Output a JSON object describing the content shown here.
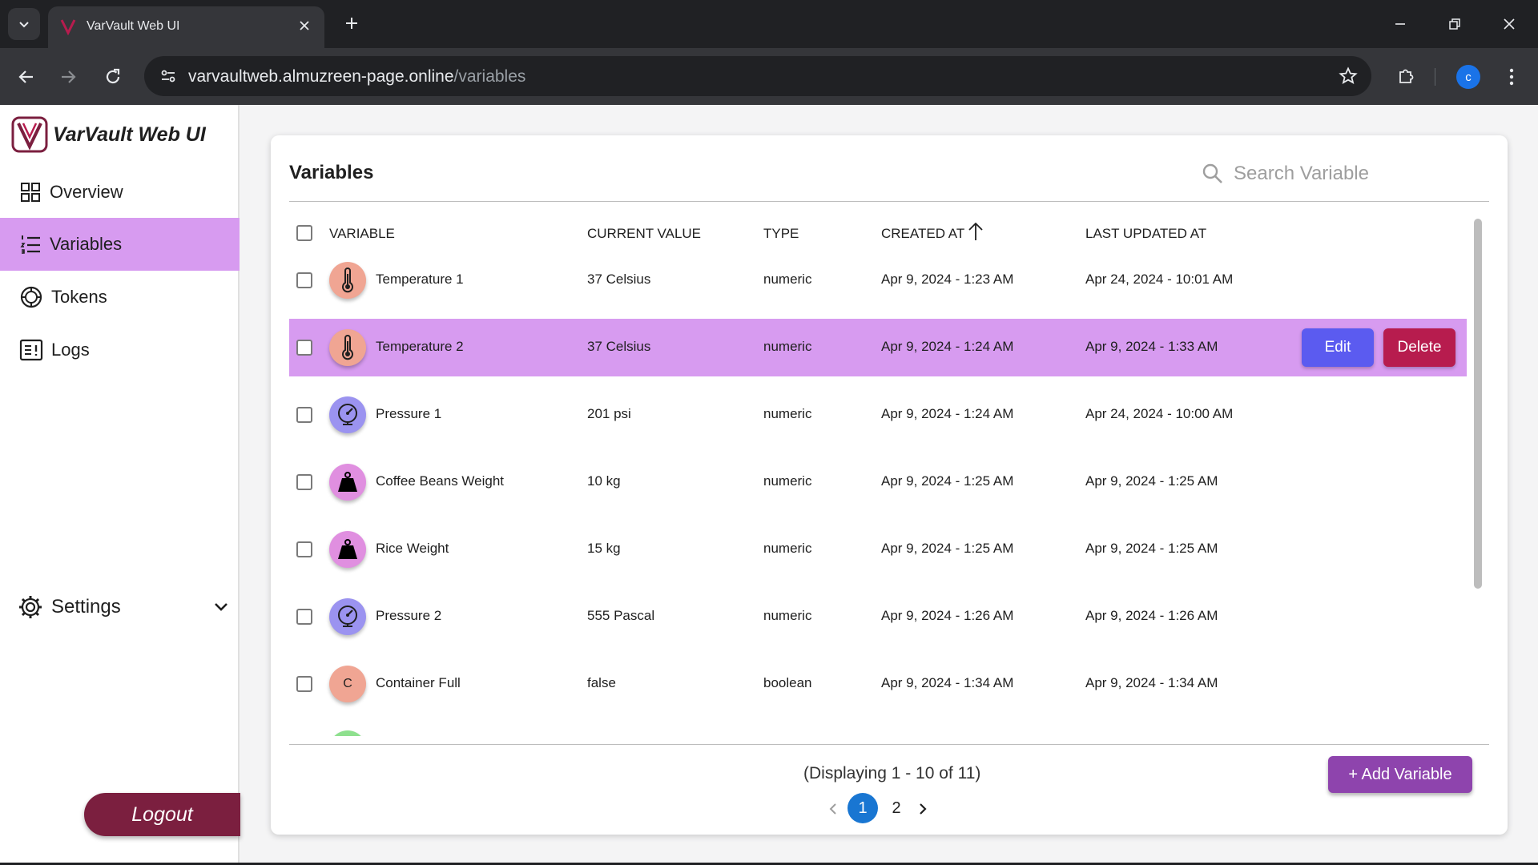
{
  "browser": {
    "tab_title": "VarVault Web UI",
    "url_domain": "varvaultweb.almuzreen-page.online",
    "url_path": "/variables",
    "profile_initial": "c"
  },
  "sidebar": {
    "brand_name": "VarVault Web UI",
    "items": [
      {
        "label": "Overview",
        "icon": "grid-icon",
        "active": false
      },
      {
        "label": "Variables",
        "icon": "list-icon",
        "active": true
      },
      {
        "label": "Tokens",
        "icon": "token-icon",
        "active": false
      },
      {
        "label": "Logs",
        "icon": "logs-icon",
        "active": false
      }
    ],
    "settings_label": "Settings",
    "logout_label": "Logout"
  },
  "main": {
    "title": "Variables",
    "search_placeholder": "Search Variable",
    "columns": {
      "variable": "VARIABLE",
      "current_value": "CURRENT VALUE",
      "type": "TYPE",
      "created_at": "CREATED AT",
      "last_updated_at": "LAST UPDATED AT"
    },
    "rows": [
      {
        "name": "Temperature 1",
        "value": "37 Celsius",
        "type": "numeric",
        "created": "Apr 9, 2024 - 1:23 AM",
        "updated": "Apr 24, 2024 - 10:01 AM",
        "icon": "thermometer-icon",
        "avatar_color": "#f0a593"
      },
      {
        "name": "Temperature 2",
        "value": "37 Celsius",
        "type": "numeric",
        "created": "Apr 9, 2024 - 1:24 AM",
        "updated": "Apr 9, 2024 - 1:33 AM",
        "icon": "thermometer-icon",
        "avatar_color": "#f0a593",
        "highlighted": true
      },
      {
        "name": "Pressure 1",
        "value": "201 psi",
        "type": "numeric",
        "created": "Apr 9, 2024 - 1:24 AM",
        "updated": "Apr 24, 2024 - 10:00 AM",
        "icon": "gauge-icon",
        "avatar_color": "#9b93f0"
      },
      {
        "name": "Coffee Beans Weight",
        "value": "10 kg",
        "type": "numeric",
        "created": "Apr 9, 2024 - 1:25 AM",
        "updated": "Apr 9, 2024 - 1:25 AM",
        "icon": "weight-icon",
        "avatar_color": "#e08fe0"
      },
      {
        "name": "Rice Weight",
        "value": "15 kg",
        "type": "numeric",
        "created": "Apr 9, 2024 - 1:25 AM",
        "updated": "Apr 9, 2024 - 1:25 AM",
        "icon": "weight-icon",
        "avatar_color": "#e08fe0"
      },
      {
        "name": "Pressure 2",
        "value": "555 Pascal",
        "type": "numeric",
        "created": "Apr 9, 2024 - 1:26 AM",
        "updated": "Apr 9, 2024 - 1:26 AM",
        "icon": "gauge-icon",
        "avatar_color": "#9b93f0"
      },
      {
        "name": "Container Full",
        "value": "false",
        "type": "boolean",
        "created": "Apr 9, 2024 - 1:34 AM",
        "updated": "Apr 9, 2024 - 1:34 AM",
        "icon": "letter-c",
        "avatar_letter": "C",
        "avatar_color": "#f0a593"
      }
    ],
    "row_actions": {
      "edit": "Edit",
      "delete": "Delete"
    },
    "display_info": "(Displaying 1 - 10 of 11)",
    "pages": [
      "1",
      "2"
    ],
    "current_page": "1",
    "add_button": "+ Add Variable"
  },
  "colors": {
    "accent": "#d79bf0",
    "edit": "#5b5bf0",
    "delete": "#b71c4e",
    "add": "#8e44ad",
    "logout": "#7b1f3f",
    "page_current": "#1976d2"
  }
}
